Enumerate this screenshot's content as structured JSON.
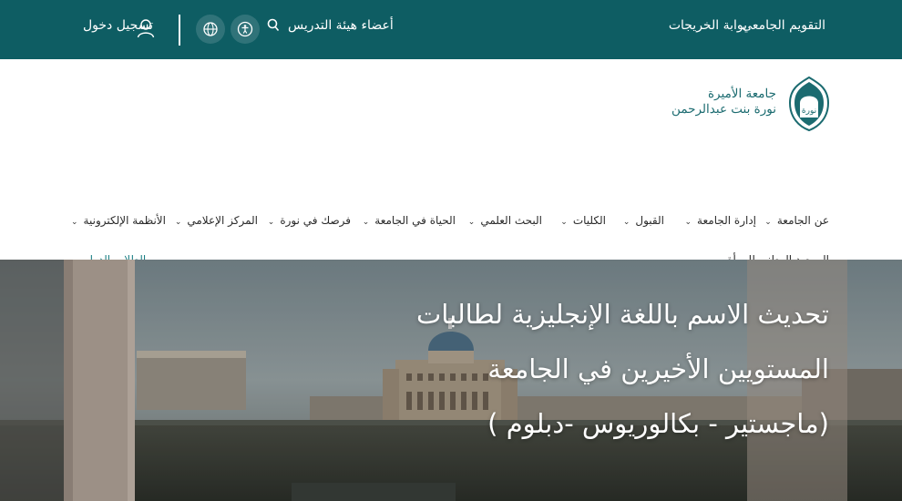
{
  "topbar": {
    "calendar_link": "التقويم الجامعي",
    "alumni_link": "بوابة الخريجات",
    "faculty_link": "أعضاء هيئة التدريس",
    "login_link": "تسجيل دخول"
  },
  "logo": {
    "line1": "جامعة الأميرة",
    "line2": "نورة بنت عبدالرحمن",
    "emblem_text": "نورة"
  },
  "nav": {
    "items": [
      "عن الجامعة",
      "إدارة الجامعة",
      "القبول",
      "الكليات",
      "البحث العلمي",
      "الحياة في الجامعة",
      "فرصك في نورة",
      "المركز الإعلامي",
      "الأنظمة الإلكترونية"
    ],
    "row2_item": "المرصد الوطني للمرأة",
    "international": "الطلاب الدوليين"
  },
  "hero": {
    "line1": "تحديث الاسم باللغة الإنجليزية لطالبات",
    "line2": "المستويين الأخيرين في الجامعة",
    "line3": "(ماجستير - بكالوريوس -دبلوم )"
  },
  "colors": {
    "topbar": "#0e5d63",
    "accent": "#1a7f84"
  }
}
